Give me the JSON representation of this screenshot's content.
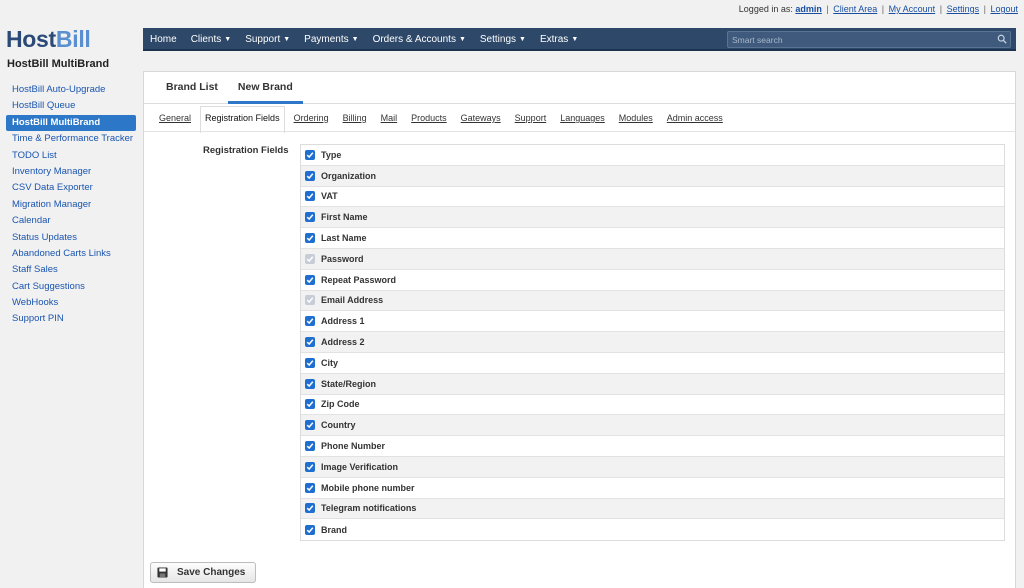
{
  "topbar": {
    "logged_in_prefix": "Logged in as:",
    "user": "admin",
    "links": [
      "Client Area",
      "My Account",
      "Settings",
      "Logout"
    ]
  },
  "logo": {
    "part1": "Host",
    "part2": "Bill"
  },
  "module_title": "HostBill MultiBrand",
  "sidebar": {
    "items": [
      {
        "label": "HostBill Auto-Upgrade",
        "active": false
      },
      {
        "label": "HostBill Queue",
        "active": false
      },
      {
        "label": "HostBill MultiBrand",
        "active": true
      },
      {
        "label": "Time & Performance Tracker",
        "active": false
      },
      {
        "label": "TODO List",
        "active": false
      },
      {
        "label": "Inventory Manager",
        "active": false
      },
      {
        "label": "CSV Data Exporter",
        "active": false
      },
      {
        "label": "Migration Manager",
        "active": false
      },
      {
        "label": "Calendar",
        "active": false
      },
      {
        "label": "Status Updates",
        "active": false
      },
      {
        "label": "Abandoned Carts Links",
        "active": false
      },
      {
        "label": "Staff Sales",
        "active": false
      },
      {
        "label": "Cart Suggestions",
        "active": false
      },
      {
        "label": "WebHooks",
        "active": false
      },
      {
        "label": "Support PIN",
        "active": false
      }
    ]
  },
  "navbar": {
    "items": [
      {
        "label": "Home",
        "dropdown": false
      },
      {
        "label": "Clients",
        "dropdown": true
      },
      {
        "label": "Support",
        "dropdown": true
      },
      {
        "label": "Payments",
        "dropdown": true
      },
      {
        "label": "Orders & Accounts",
        "dropdown": true
      },
      {
        "label": "Settings",
        "dropdown": true
      },
      {
        "label": "Extras",
        "dropdown": true
      }
    ],
    "search_placeholder": "Smart search"
  },
  "panel_tabs": [
    {
      "label": "Brand List",
      "active": false
    },
    {
      "label": "New Brand",
      "active": true
    }
  ],
  "subtabs": [
    {
      "label": "General",
      "active": false
    },
    {
      "label": "Registration Fields",
      "active": true
    },
    {
      "label": "Ordering",
      "active": false
    },
    {
      "label": "Billing",
      "active": false
    },
    {
      "label": "Mail",
      "active": false
    },
    {
      "label": "Products",
      "active": false
    },
    {
      "label": "Gateways",
      "active": false
    },
    {
      "label": "Support",
      "active": false
    },
    {
      "label": "Languages",
      "active": false
    },
    {
      "label": "Modules",
      "active": false
    },
    {
      "label": "Admin access",
      "active": false
    }
  ],
  "form": {
    "label": "Registration Fields",
    "fields": [
      {
        "label": "Type",
        "checked": true,
        "disabled": false
      },
      {
        "label": "Organization",
        "checked": true,
        "disabled": false
      },
      {
        "label": "VAT",
        "checked": true,
        "disabled": false
      },
      {
        "label": "First Name",
        "checked": true,
        "disabled": false
      },
      {
        "label": "Last Name",
        "checked": true,
        "disabled": false
      },
      {
        "label": "Password",
        "checked": true,
        "disabled": true
      },
      {
        "label": "Repeat Password",
        "checked": true,
        "disabled": false
      },
      {
        "label": "Email Address",
        "checked": true,
        "disabled": true
      },
      {
        "label": "Address 1",
        "checked": true,
        "disabled": false
      },
      {
        "label": "Address 2",
        "checked": true,
        "disabled": false
      },
      {
        "label": "City",
        "checked": true,
        "disabled": false
      },
      {
        "label": "State/Region",
        "checked": true,
        "disabled": false
      },
      {
        "label": "Zip Code",
        "checked": true,
        "disabled": false
      },
      {
        "label": "Country",
        "checked": true,
        "disabled": false
      },
      {
        "label": "Phone Number",
        "checked": true,
        "disabled": false
      },
      {
        "label": "Image Verification",
        "checked": true,
        "disabled": false
      },
      {
        "label": "Mobile phone number",
        "checked": true,
        "disabled": false
      },
      {
        "label": "Telegram notifications",
        "checked": true,
        "disabled": false
      },
      {
        "label": "Brand",
        "checked": true,
        "disabled": false
      }
    ],
    "save_label": "Save Changes"
  },
  "colors": {
    "accent": "#2d77c9",
    "navbar": "#2d4868",
    "checkbox": "#1e6fd0",
    "checkbox_disabled": "#c6cdd6"
  },
  "icons": {
    "search": "search-icon",
    "checkbox": "checkmark-icon",
    "save": "floppy-disk-icon",
    "caret": "caret-down-icon"
  }
}
